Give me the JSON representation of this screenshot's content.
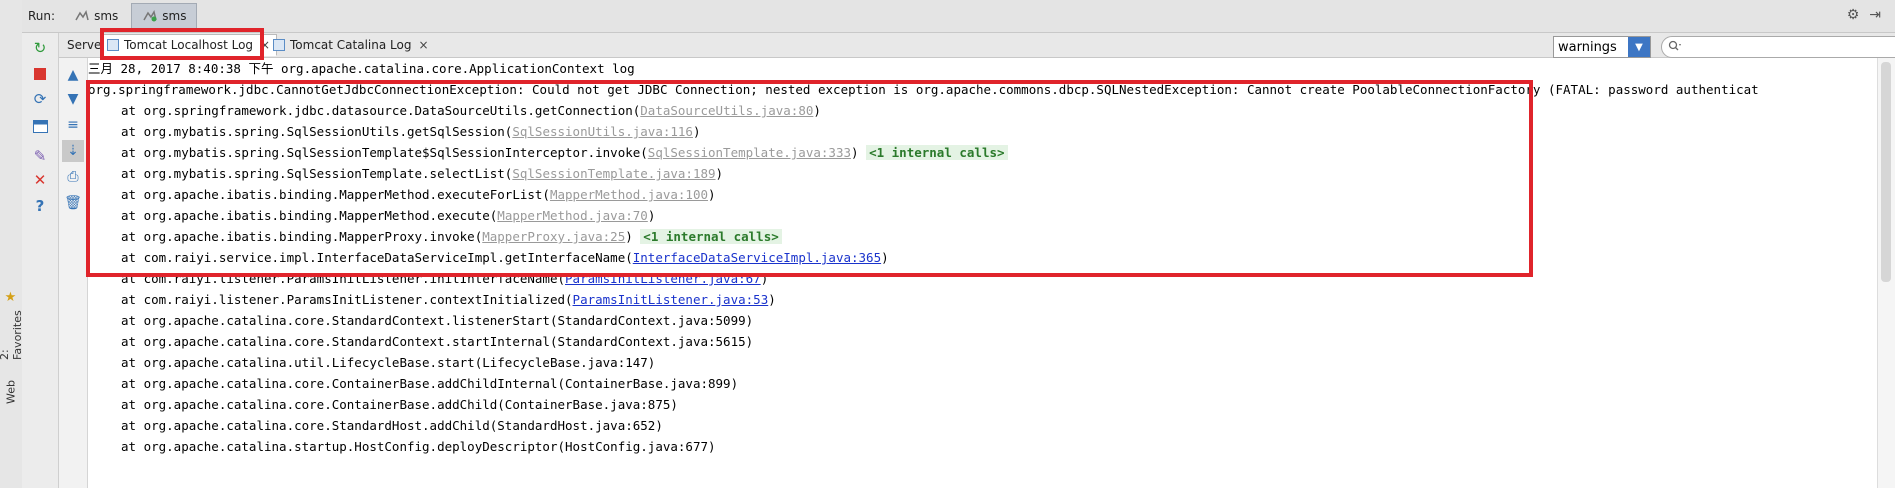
{
  "run_bar": {
    "label": "Run:",
    "tabs": [
      {
        "label": "sms",
        "active": false
      },
      {
        "label": "sms",
        "active": true
      }
    ]
  },
  "left_strip": {
    "favorites_label": "2: Favorites",
    "web_label": "Web"
  },
  "tabs": [
    {
      "label": "Server"
    },
    {
      "label": "Tomcat Localhost Log",
      "active": true,
      "close": "×"
    },
    {
      "label": "Tomcat Catalina Log",
      "close": "×"
    }
  ],
  "filter": {
    "selected": "warnings",
    "search_placeholder": "",
    "search_icon": "search-icon"
  },
  "log": {
    "header": "三月 28, 2017 8:40:38 下午 org.apache.catalina.core.ApplicationContext log",
    "exception": "org.springframework.jdbc.CannotGetJdbcConnectionException: Could not get JDBC Connection; nested exception is org.apache.commons.dbcp.SQLNestedException: Cannot create PoolableConnectionFactory (FATAL: password authenticat",
    "frames": [
      {
        "text": "at org.springframework.jdbc.datasource.DataSourceUtils.getConnection(",
        "link": "DataSourceUtils.java:80",
        "link_style": "grey",
        "suffix": ")"
      },
      {
        "text": "at org.mybatis.spring.SqlSessionUtils.getSqlSession(",
        "link": "SqlSessionUtils.java:116",
        "link_style": "grey",
        "suffix": ")"
      },
      {
        "text": "at org.mybatis.spring.SqlSessionTemplate$SqlSessionInterceptor.invoke(",
        "link": "SqlSessionTemplate.java:333",
        "link_style": "grey",
        "suffix": ")",
        "internal": "<1 internal calls>"
      },
      {
        "text": "at org.mybatis.spring.SqlSessionTemplate.selectList(",
        "link": "SqlSessionTemplate.java:189",
        "link_style": "grey",
        "suffix": ")"
      },
      {
        "text": "at org.apache.ibatis.binding.MapperMethod.executeForList(",
        "link": "MapperMethod.java:100",
        "link_style": "grey",
        "suffix": ")"
      },
      {
        "text": "at org.apache.ibatis.binding.MapperMethod.execute(",
        "link": "MapperMethod.java:70",
        "link_style": "grey",
        "suffix": ")"
      },
      {
        "text": "at org.apache.ibatis.binding.MapperProxy.invoke(",
        "link": "MapperProxy.java:25",
        "link_style": "grey",
        "suffix": ")",
        "internal": "<1 internal calls>"
      },
      {
        "text": "at com.raiyi.service.impl.InterfaceDataServiceImpl.getInterfaceName(",
        "link": "InterfaceDataServiceImpl.java:365",
        "link_style": "blue",
        "suffix": ")"
      },
      {
        "text": "at com.raiyi.listener.ParamsInitListener.initInterfaceName(",
        "link": "ParamsInitListener.java:67",
        "link_style": "blue",
        "suffix": ")"
      },
      {
        "text": "at com.raiyi.listener.ParamsInitListener.contextInitialized(",
        "link": "ParamsInitListener.java:53",
        "link_style": "blue",
        "suffix": ")"
      },
      {
        "text": "at org.apache.catalina.core.StandardContext.listenerStart(StandardContext.java:5099)",
        "link": "",
        "link_style": "none",
        "suffix": ""
      },
      {
        "text": "at org.apache.catalina.core.StandardContext.startInternal(StandardContext.java:5615)",
        "link": "",
        "link_style": "none",
        "suffix": ""
      },
      {
        "text": "at org.apache.catalina.util.LifecycleBase.start(LifecycleBase.java:147)",
        "link": "",
        "link_style": "none",
        "suffix": ""
      },
      {
        "text": "at org.apache.catalina.core.ContainerBase.addChildInternal(ContainerBase.java:899)",
        "link": "",
        "link_style": "none",
        "suffix": ""
      },
      {
        "text": "at org.apache.catalina.core.ContainerBase.addChild(ContainerBase.java:875)",
        "link": "",
        "link_style": "none",
        "suffix": ""
      },
      {
        "text": "at org.apache.catalina.core.StandardHost.addChild(StandardHost.java:652)",
        "link": "",
        "link_style": "none",
        "suffix": ""
      },
      {
        "text": "at org.apache.catalina.startup.HostConfig.deployDescriptor(HostConfig.java:677)",
        "link": "",
        "link_style": "none",
        "suffix": ""
      }
    ]
  },
  "colors": {
    "annotation_red": "#e0242b",
    "link_blue": "#1a33cc",
    "link_grey": "#9a9a9a",
    "internal_green": "#2b7a2b",
    "dropdown_blue": "#3d76c4"
  }
}
